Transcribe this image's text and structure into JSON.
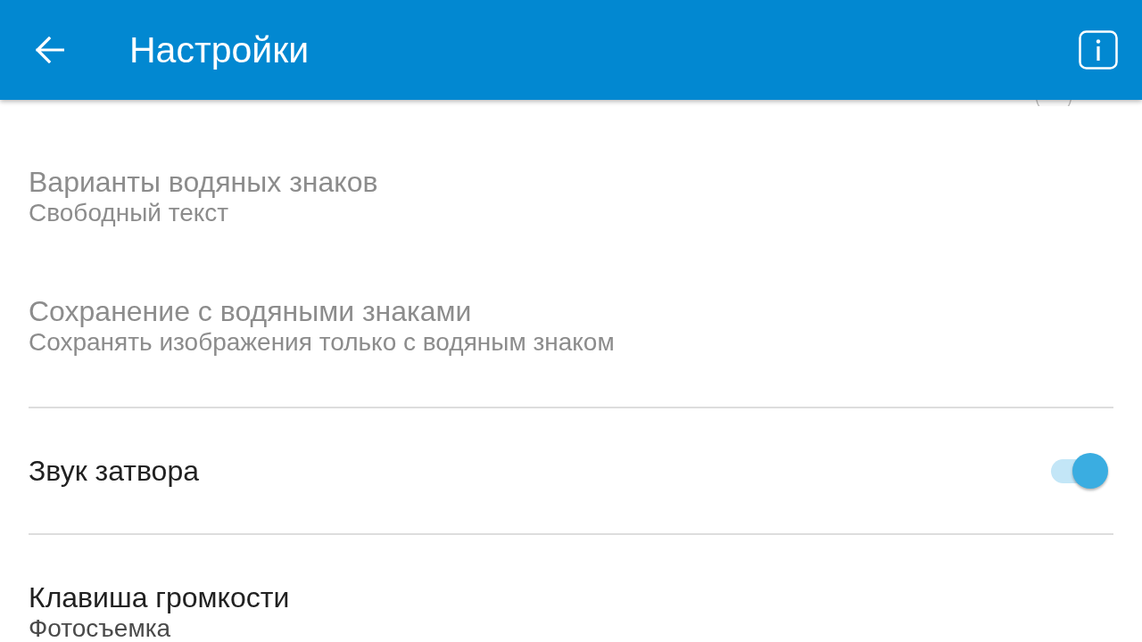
{
  "app_bar": {
    "title": "Настройки"
  },
  "partially_hidden_item": {
    "kind": "switch",
    "on": false
  },
  "groups": [
    {
      "items": [
        {
          "kind": "text",
          "title": "Варианты водяных знаков",
          "subtitle": "Свободный текст",
          "disabled": true
        },
        {
          "kind": "text",
          "title": "Сохранение с водяными знаками",
          "subtitle": "Сохранять изображения только с водяным знаком",
          "disabled": true
        }
      ]
    },
    {
      "items": [
        {
          "kind": "switch",
          "title": "Звук затвора",
          "on": true,
          "disabled": false
        }
      ]
    },
    {
      "items": [
        {
          "kind": "text",
          "title": "Клавиша громкости",
          "subtitle": "Фотосъемка",
          "disabled": false
        }
      ]
    }
  ]
}
